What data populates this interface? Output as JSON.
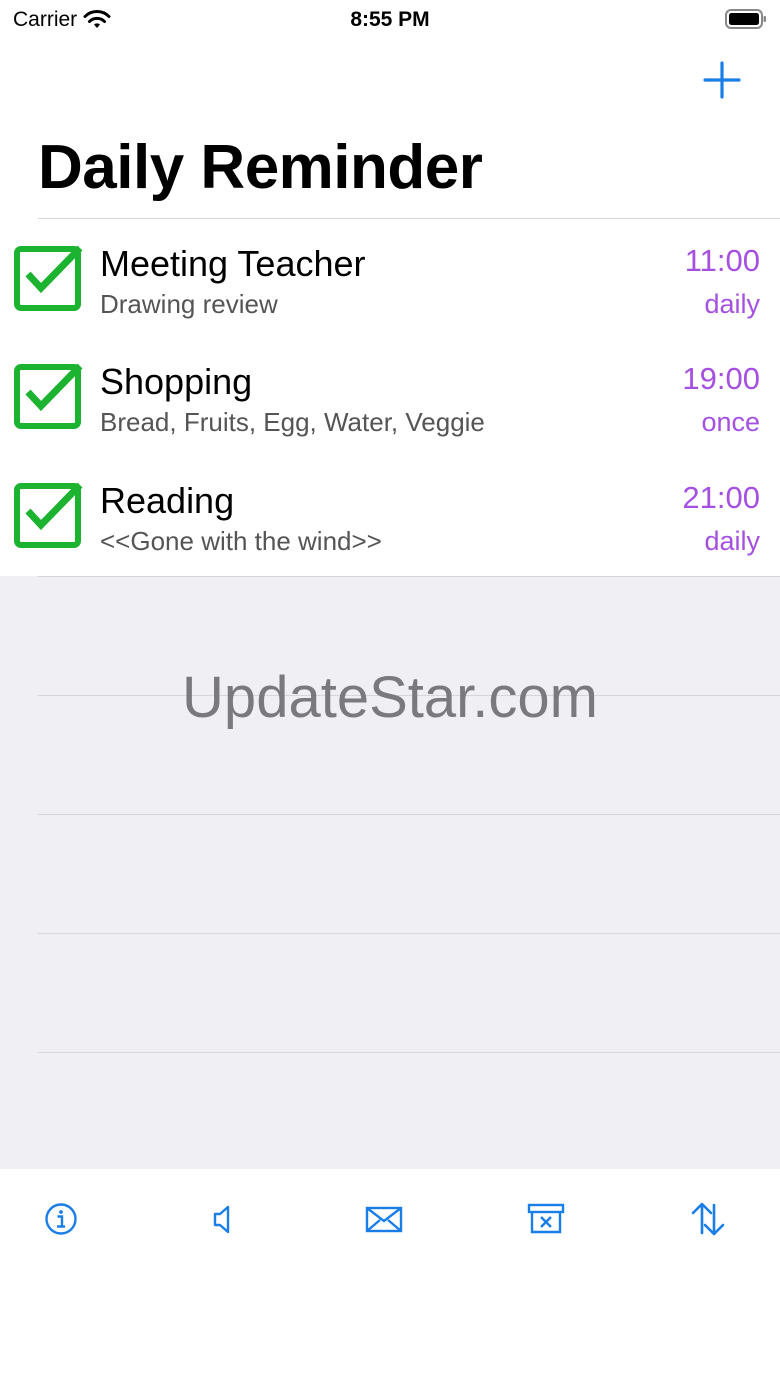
{
  "status_bar": {
    "carrier": "Carrier",
    "time": "8:55 PM",
    "wifi_icon": "wifi-icon",
    "battery_icon": "battery-icon"
  },
  "nav": {
    "add_icon": "plus-icon",
    "title": "Daily Reminder"
  },
  "colors": {
    "accent": "#1a7ee8",
    "check": "#1cb330",
    "time": "#a550e0",
    "background_empty": "#efeff4"
  },
  "reminders": [
    {
      "title": "Meeting Teacher",
      "subtitle": "Drawing review",
      "time": "11:00",
      "frequency": "daily",
      "checked": true
    },
    {
      "title": "Shopping",
      "subtitle": "Bread, Fruits, Egg, Water, Veggie",
      "time": "19:00",
      "frequency": "once",
      "checked": true
    },
    {
      "title": "Reading",
      "subtitle": "<<Gone with the wind>>",
      "time": "21:00",
      "frequency": "daily",
      "checked": true
    }
  ],
  "watermark": "UpdateStar.com",
  "toolbar": {
    "items": [
      "info-icon",
      "speaker-icon",
      "mail-icon",
      "archive-delete-icon",
      "sort-arrows-icon"
    ]
  }
}
